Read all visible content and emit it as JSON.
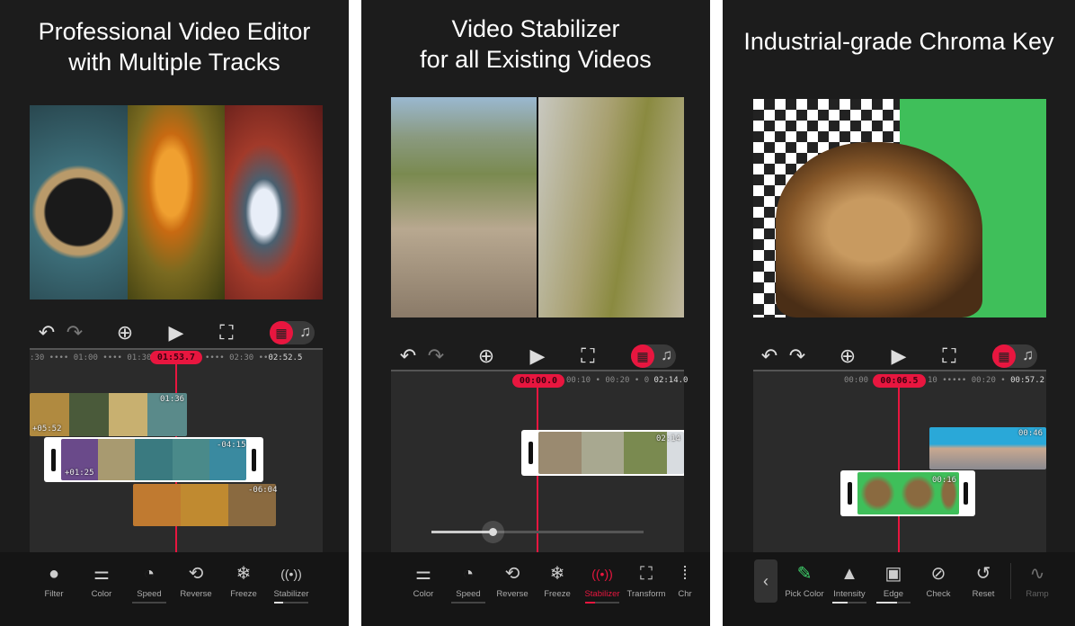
{
  "panels": [
    {
      "title_lines": [
        "Professional Video Editor",
        "with Multiple Tracks"
      ],
      "ruler": ":30 •••• 01:00 •••• 01:30",
      "ruler_after": "•••• 02:30 ••",
      "total": "02:52.5",
      "playhead": "01:53.7",
      "clips": [
        "+05:52",
        "01:36",
        "+01:25",
        "-04:15",
        "-06:04"
      ],
      "tools": [
        {
          "icon": "filter-icon",
          "glyph": "●",
          "label": "Filter"
        },
        {
          "icon": "color-sliders-icon",
          "glyph": "⚌",
          "label": "Color"
        },
        {
          "icon": "speed-gauge-icon",
          "glyph": "◔",
          "label": "Speed"
        },
        {
          "icon": "reverse-icon",
          "glyph": "⟲",
          "label": "Reverse"
        },
        {
          "icon": "freeze-snowflake-icon",
          "glyph": "❄",
          "label": "Freeze"
        },
        {
          "icon": "stabilizer-icon",
          "glyph": "((•))",
          "label": "Stabilizer"
        }
      ]
    },
    {
      "title_lines": [
        "Video Stabilizer",
        "for all Existing Videos"
      ],
      "ruler": "00:10 • 00:20 • 0",
      "total": "02:14.0",
      "playhead": "00:00.0",
      "clips": [
        "02:14"
      ],
      "stabilizer_strength": 0.29,
      "tools": [
        {
          "icon": "color-sliders-icon",
          "glyph": "⚌",
          "label": "Color"
        },
        {
          "icon": "speed-gauge-icon",
          "glyph": "◔",
          "label": "Speed"
        },
        {
          "icon": "reverse-icon",
          "glyph": "⟲",
          "label": "Reverse"
        },
        {
          "icon": "freeze-snowflake-icon",
          "glyph": "❄",
          "label": "Freeze"
        },
        {
          "icon": "stabilizer-icon",
          "glyph": "((•))",
          "label": "Stabilizer"
        },
        {
          "icon": "transform-icon",
          "glyph": "⛶",
          "label": "Transform"
        },
        {
          "icon": "chroma-icon",
          "glyph": "⁞",
          "label": "Chr"
        }
      ]
    },
    {
      "title_lines": [
        "Industrial-grade Chroma Key"
      ],
      "ruler_before": "00:00",
      "ruler": "10 ••••• 00:20 •",
      "total": "00:57.2",
      "playhead": "00:06.5",
      "clips": [
        "00:46",
        "00:16"
      ],
      "tools": [
        {
          "icon": "pick-color-icon",
          "glyph": "✎",
          "label": "Pick Color"
        },
        {
          "icon": "intensity-icon",
          "glyph": "▲",
          "label": "Intensity"
        },
        {
          "icon": "edge-icon",
          "glyph": "▣",
          "label": "Edge"
        },
        {
          "icon": "check-eye-icon",
          "glyph": "⊘",
          "label": "Check"
        },
        {
          "icon": "reset-icon",
          "glyph": "↺",
          "label": "Reset"
        },
        {
          "icon": "ramp-icon",
          "glyph": "∿",
          "label": "Ramp"
        }
      ]
    }
  ],
  "toolbar": {
    "undo": "↶",
    "redo": "↷",
    "add": "⊕",
    "play": "▶",
    "fullscreen": "⛶",
    "video": "▦",
    "audio": "♫"
  },
  "colors": {
    "accent": "#e8163f",
    "background": "#1c1c1c",
    "timeline": "#2b2b2b"
  }
}
